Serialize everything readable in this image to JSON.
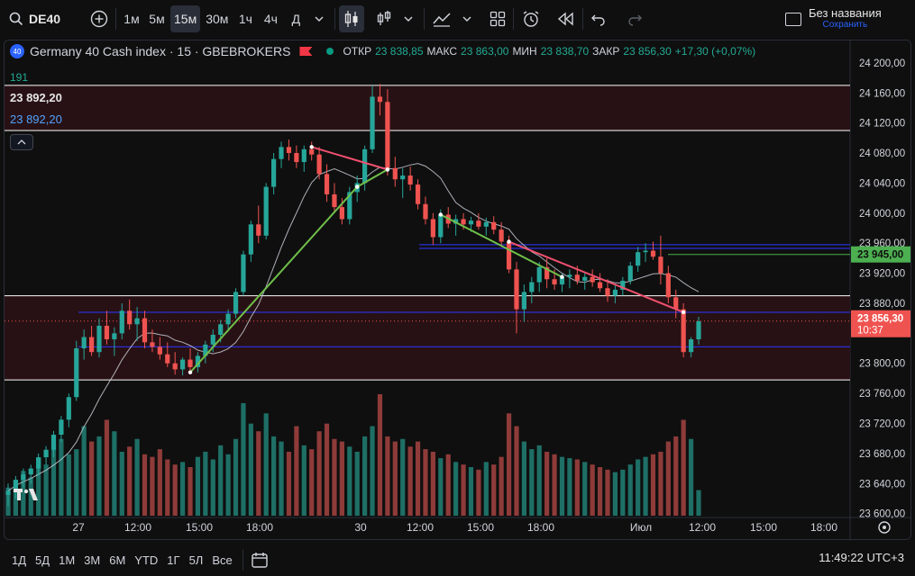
{
  "toolbar": {
    "symbol": "DE40",
    "intervals": [
      "1м",
      "5м",
      "15м",
      "30м",
      "1ч",
      "4ч",
      "Д"
    ],
    "active_interval": "15м",
    "layout_title": "Без названия",
    "layout_status": "Сохранить"
  },
  "legend": {
    "badge": "40",
    "name": "Germany 40 Cash index · 15 · GBEBROKERS",
    "open_label": "ОТКР",
    "open": "23 838,85",
    "high_label": "МАКС",
    "high": "23 863,00",
    "low_label": "МИН",
    "low": "23 838,70",
    "close_label": "ЗАКР",
    "close": "23 856,30",
    "change": "+17,30 (+0,07%)"
  },
  "indicator": {
    "value": "191",
    "price_top": "23 892,20",
    "price_sub": "23 892,20"
  },
  "price_axis": {
    "ticks": [
      "24 200,00",
      "24 160,00",
      "24 120,00",
      "24 080,00",
      "24 040,00",
      "24 000,00",
      "23 960,00",
      "23 920,00",
      "23 880,00",
      "23 840,00",
      "23 800,00",
      "23 760,00",
      "23 720,00",
      "23 680,00",
      "23 640,00",
      "23 600,00"
    ],
    "green_label": "23 945,00",
    "current_label": "23 856,30",
    "countdown": "10:37"
  },
  "time_axis": {
    "ticks": [
      "27",
      "12:00",
      "15:00",
      "18:00",
      "30",
      "12:00",
      "15:00",
      "18:00",
      "Июл",
      "12:00",
      "15:00",
      "18:00"
    ]
  },
  "bottom": {
    "ranges": [
      "1Д",
      "5Д",
      "1М",
      "3М",
      "6М",
      "YTD",
      "1Г",
      "5Л",
      "Все"
    ],
    "clock": "11:49:22 UTC+3"
  },
  "colors": {
    "up": "#26a69a",
    "down": "#ef5350",
    "up_vol": "#1e6f66",
    "down_vol": "#8e3b39",
    "ma": "#c8cdd6",
    "trend_up": "#6fbf4a",
    "trend_down": "#f0506e",
    "zone": "#2a1215",
    "hline": "#ffffff",
    "blue_line": "#2a2fd6",
    "green_line": "#4caf50"
  },
  "chart_data": {
    "type": "candlestick",
    "title": "Germany 40 Cash index · 15 · GBEBROKERS",
    "ylim": [
      23590,
      24225
    ],
    "candles": [
      [
        23625,
        23640,
        23610,
        23630
      ],
      [
        23630,
        23650,
        23620,
        23645
      ],
      [
        23645,
        23660,
        23635,
        23652
      ],
      [
        23652,
        23665,
        23640,
        23660
      ],
      [
        23660,
        23680,
        23650,
        23675
      ],
      [
        23675,
        23690,
        23665,
        23685
      ],
      [
        23685,
        23710,
        23675,
        23705
      ],
      [
        23705,
        23730,
        23695,
        23725
      ],
      [
        23725,
        23760,
        23715,
        23755
      ],
      [
        23755,
        23830,
        23750,
        23820
      ],
      [
        23820,
        23845,
        23805,
        23835
      ],
      [
        23835,
        23850,
        23810,
        23815
      ],
      [
        23815,
        23860,
        23808,
        23850
      ],
      [
        23850,
        23870,
        23825,
        23832
      ],
      [
        23832,
        23848,
        23810,
        23840
      ],
      [
        23840,
        23880,
        23832,
        23870
      ],
      [
        23870,
        23885,
        23845,
        23852
      ],
      [
        23852,
        23875,
        23830,
        23860
      ],
      [
        23860,
        23870,
        23820,
        23828
      ],
      [
        23828,
        23845,
        23815,
        23822
      ],
      [
        23822,
        23835,
        23805,
        23812
      ],
      [
        23812,
        23828,
        23795,
        23800
      ],
      [
        23800,
        23815,
        23785,
        23792
      ],
      [
        23792,
        23808,
        23784,
        23805
      ],
      [
        23805,
        23820,
        23790,
        23795
      ],
      [
        23795,
        23815,
        23788,
        23810
      ],
      [
        23810,
        23830,
        23800,
        23825
      ],
      [
        23825,
        23845,
        23815,
        23838
      ],
      [
        23838,
        23858,
        23828,
        23852
      ],
      [
        23852,
        23872,
        23842,
        23866
      ],
      [
        23866,
        23900,
        23860,
        23895
      ],
      [
        23895,
        23950,
        23890,
        23945
      ],
      [
        23945,
        23990,
        23935,
        23985
      ],
      [
        23985,
        24010,
        23960,
        23970
      ],
      [
        23970,
        24040,
        23965,
        24035
      ],
      [
        24035,
        24080,
        24025,
        24072
      ],
      [
        24072,
        24095,
        24060,
        24088
      ],
      [
        24088,
        24098,
        24070,
        24080
      ],
      [
        24080,
        24090,
        24060,
        24068
      ],
      [
        24068,
        24090,
        24055,
        24085
      ],
      [
        24085,
        24095,
        24070,
        24078
      ],
      [
        24078,
        24088,
        24045,
        24052
      ],
      [
        24052,
        24065,
        24015,
        24025
      ],
      [
        24025,
        24040,
        24000,
        24008
      ],
      [
        24008,
        24020,
        23985,
        23992
      ],
      [
        23992,
        24035,
        23985,
        24028
      ],
      [
        24028,
        24050,
        24015,
        24040
      ],
      [
        24040,
        24090,
        24030,
        24085
      ],
      [
        24085,
        24170,
        24080,
        24155
      ],
      [
        24155,
        24172,
        24130,
        24148
      ],
      [
        24148,
        24165,
        24050,
        24060
      ],
      [
        24060,
        24075,
        24035,
        24045
      ],
      [
        24045,
        24060,
        24020,
        24050
      ],
      [
        24050,
        24062,
        24030,
        24038
      ],
      [
        24038,
        24045,
        24005,
        24012
      ],
      [
        24012,
        24022,
        23985,
        23992
      ],
      [
        23992,
        24000,
        23958,
        23968
      ],
      [
        23968,
        24005,
        23960,
        23998
      ],
      [
        23998,
        24008,
        23980,
        23986
      ],
      [
        23986,
        23998,
        23970,
        23992
      ],
      [
        23992,
        24000,
        23978,
        23985
      ],
      [
        23985,
        23995,
        23975,
        23990
      ],
      [
        23990,
        24000,
        23978,
        23982
      ],
      [
        23982,
        23994,
        23970,
        23988
      ],
      [
        23988,
        23996,
        23972,
        23978
      ],
      [
        23978,
        23988,
        23955,
        23962
      ],
      [
        23962,
        23970,
        23920,
        23925
      ],
      [
        23925,
        23935,
        23840,
        23872
      ],
      [
        23872,
        23905,
        23855,
        23895
      ],
      [
        23895,
        23915,
        23880,
        23908
      ],
      [
        23908,
        23935,
        23895,
        23928
      ],
      [
        23928,
        23940,
        23900,
        23912
      ],
      [
        23912,
        23925,
        23898,
        23905
      ],
      [
        23905,
        23920,
        23895,
        23915
      ],
      [
        23915,
        23925,
        23900,
        23918
      ],
      [
        23918,
        23930,
        23905,
        23910
      ],
      [
        23910,
        23922,
        23898,
        23915
      ],
      [
        23915,
        23925,
        23902,
        23908
      ],
      [
        23908,
        23920,
        23895,
        23900
      ],
      [
        23900,
        23912,
        23882,
        23890
      ],
      [
        23890,
        23905,
        23880,
        23898
      ],
      [
        23898,
        23915,
        23890,
        23910
      ],
      [
        23910,
        23935,
        23905,
        23930
      ],
      [
        23930,
        23955,
        23922,
        23948
      ],
      [
        23948,
        23960,
        23935,
        23950
      ],
      [
        23950,
        23962,
        23938,
        23942
      ],
      [
        23942,
        23970,
        23905,
        23920
      ],
      [
        23920,
        23930,
        23880,
        23888
      ],
      [
        23888,
        23898,
        23860,
        23872
      ],
      [
        23872,
        23880,
        23808,
        23815
      ],
      [
        23815,
        23835,
        23808,
        23832
      ],
      [
        23832,
        23862,
        23825,
        23856
      ]
    ],
    "volume": [
      22,
      28,
      35,
      30,
      45,
      40,
      55,
      60,
      48,
      52,
      70,
      58,
      62,
      75,
      66,
      50,
      54,
      60,
      48,
      46,
      52,
      44,
      40,
      42,
      38,
      46,
      50,
      44,
      55,
      48,
      60,
      88,
      72,
      66,
      80,
      62,
      58,
      50,
      70,
      55,
      52,
      66,
      72,
      60,
      58,
      54,
      50,
      62,
      70,
      95,
      62,
      58,
      60,
      54,
      58,
      52,
      50,
      45,
      48,
      42,
      40,
      38,
      36,
      42,
      40,
      46,
      80,
      70,
      58,
      52,
      55,
      50,
      48,
      46,
      45,
      44,
      42,
      40,
      38,
      36,
      34,
      36,
      40,
      44,
      46,
      48,
      50,
      58,
      62,
      75,
      60,
      20
    ],
    "hlines_white": [
      24170,
      24110,
      23890,
      23778
    ],
    "zones": [
      [
        24110,
        24170
      ],
      [
        23778,
        23890
      ]
    ],
    "hlines_blue": [
      23958,
      23953,
      23868,
      23822
    ],
    "hline_green": 23945,
    "current_price": 23856.3
  }
}
